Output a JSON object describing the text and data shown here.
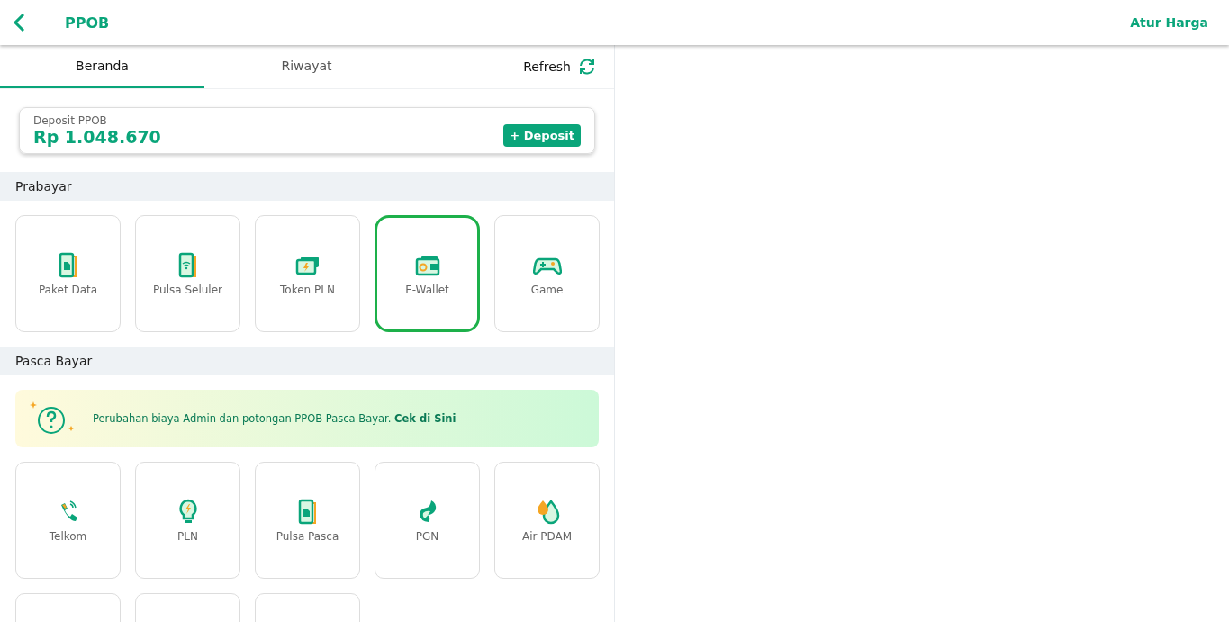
{
  "header": {
    "title": "PPOB",
    "action": "Atur Harga"
  },
  "tabs": [
    {
      "label": "Beranda",
      "selected": true
    },
    {
      "label": "Riwayat",
      "selected": false
    }
  ],
  "refresh": {
    "label": "Refresh"
  },
  "deposit": {
    "label": "Deposit PPOB",
    "amount": "Rp 1.048.670",
    "button": "+ Deposit"
  },
  "prabayar": {
    "title": "Prabayar",
    "items": [
      {
        "label": "Paket Data",
        "kind": "sim",
        "selected": false
      },
      {
        "label": "Pulsa Seluler",
        "kind": "phone-wifi",
        "selected": false
      },
      {
        "label": "Token PLN",
        "kind": "token",
        "selected": false
      },
      {
        "label": "E-Wallet",
        "kind": "wallet",
        "selected": true
      },
      {
        "label": "Game",
        "kind": "gamepad",
        "selected": false
      }
    ]
  },
  "pasca_bayar": {
    "title": "Pasca Bayar",
    "notice": {
      "text": "Perubahan biaya Admin dan potongan PPOB Pasca Bayar.",
      "link": "Cek di Sini"
    },
    "items": [
      {
        "label": "Telkom",
        "kind": "telephone",
        "selected": false
      },
      {
        "label": "PLN",
        "kind": "bulb",
        "selected": false
      },
      {
        "label": "Pulsa Pasca",
        "kind": "sim",
        "selected": false
      },
      {
        "label": "PGN",
        "kind": "flame",
        "selected": false
      },
      {
        "label": "Air PDAM",
        "kind": "drops",
        "selected": false
      },
      {
        "kind": "cut",
        "selected": false
      },
      {
        "kind": "cut",
        "selected": false
      },
      {
        "kind": "cut",
        "selected": false
      }
    ]
  }
}
